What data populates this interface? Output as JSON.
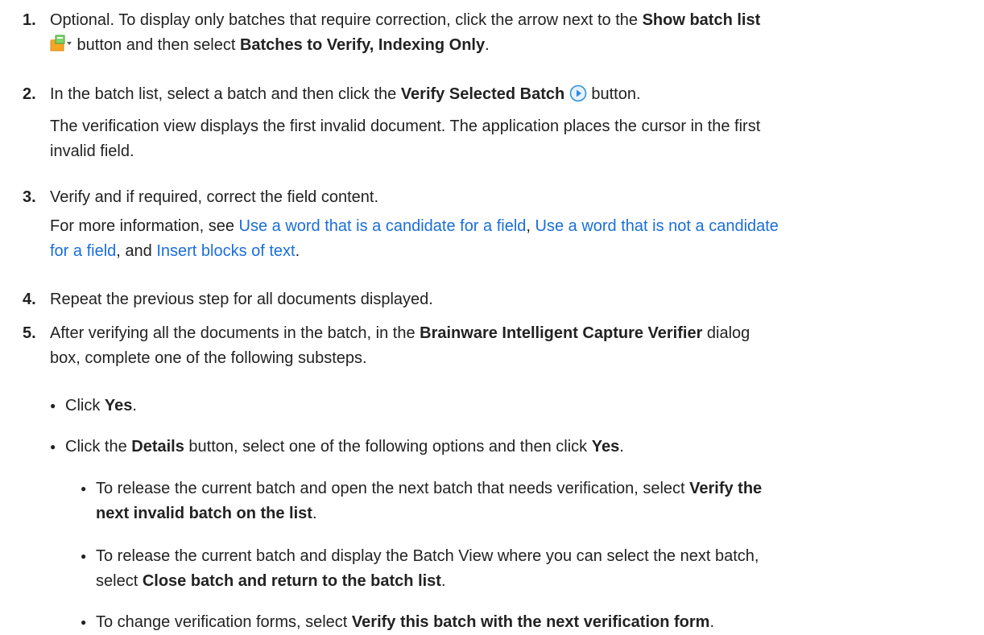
{
  "steps": [
    {
      "number": "1.",
      "line1_a": "Optional. To display only batches that require correction, click the arrow next to the ",
      "line1_b": "Show batch list",
      "line2_a": " button and then select ",
      "line2_b": "Batches to Verify, Indexing Only",
      "line2_c": ".",
      "icon": "show-batch-list-icon"
    },
    {
      "number": "2.",
      "a": "In the batch list, select a batch and then click the ",
      "b": "Verify Selected Batch",
      "c": " button.",
      "icon": "verify-play-icon",
      "note_line1": "The verification view displays the first invalid document. The application places the cursor in the first",
      "note_line2": "invalid field."
    },
    {
      "number": "3.",
      "a": "Verify and if required, correct the field content.",
      "more_a": "For more information, see ",
      "link1": "Use a word that is a candidate for a field",
      "sep1": ", ",
      "link2a": "Use a word that is not a candidate",
      "link2b": "for a field",
      "sep2": ", and ",
      "link3": "Insert blocks of text",
      "end": "."
    },
    {
      "number": "4.",
      "a": "Repeat the previous step for all documents displayed."
    },
    {
      "number": "5.",
      "a": "After verifying all the documents in the batch, in the ",
      "b": "Brainware Intelligent Capture Verifier",
      "c": " dialog",
      "d": "box, complete one of the following substeps.",
      "sub1_a": "Click ",
      "sub1_b": "Yes",
      "sub1_c": ".",
      "sub2_a": "Click the ",
      "sub2_b": "Details",
      "sub2_c": " button, select one of the following options and then click ",
      "sub2_d": "Yes",
      "sub2_e": ".",
      "opt1_a": "To release the current batch and open the next batch that needs verification, select ",
      "opt1_b": "Verify the",
      "opt1_c": "next invalid batch on the list",
      "opt1_d": ".",
      "opt2_a": "To release the current batch and display the Batch View where you can select the next batch,",
      "opt2_b": "select ",
      "opt2_c": "Close batch and return to the batch list",
      "opt2_d": ".",
      "opt3_a": "To change verification forms, select ",
      "opt3_b": "Verify this batch with the next verification form",
      "opt3_c": "."
    }
  ],
  "colors": {
    "text": "#222222",
    "link": "#1a6ed8",
    "icon_play": "#2b8ee0"
  }
}
